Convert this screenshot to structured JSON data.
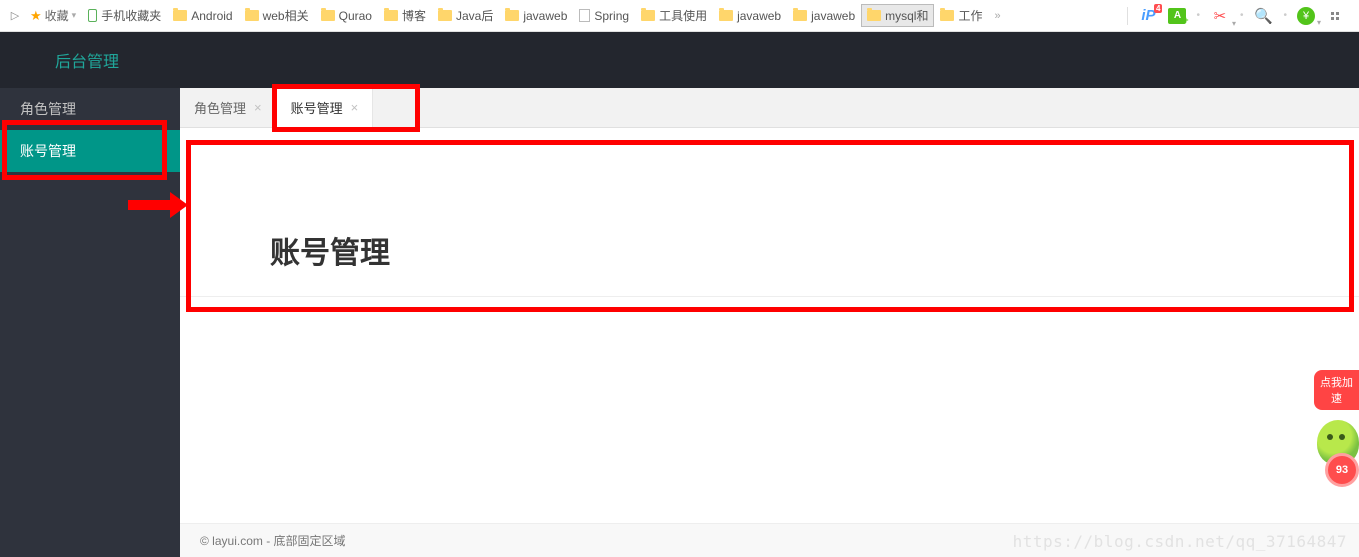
{
  "browser": {
    "favorites_label": "收藏",
    "bookmarks": [
      {
        "label": "手机收藏夹",
        "icon": "phone"
      },
      {
        "label": "Android",
        "icon": "folder"
      },
      {
        "label": "web相关",
        "icon": "folder"
      },
      {
        "label": "Qurao",
        "icon": "folder"
      },
      {
        "label": "博客",
        "icon": "folder"
      },
      {
        "label": "Java后",
        "icon": "folder"
      },
      {
        "label": "javaweb",
        "icon": "folder"
      },
      {
        "label": "Spring",
        "icon": "page"
      },
      {
        "label": "工具使用",
        "icon": "folder"
      },
      {
        "label": "javaweb",
        "icon": "folder"
      },
      {
        "label": "javaweb",
        "icon": "folder"
      },
      {
        "label": "mysql和",
        "icon": "folder",
        "selected": true
      },
      {
        "label": "工作",
        "icon": "folder"
      }
    ],
    "more": "»",
    "toolbar_badge": "4",
    "toolbar_a": "A",
    "toolbar_yen": "¥"
  },
  "app": {
    "title": "后台管理",
    "sidebar": [
      {
        "label": "角色管理",
        "active": false
      },
      {
        "label": "账号管理",
        "active": true
      }
    ],
    "tabs": [
      {
        "label": "角色管理",
        "active": false
      },
      {
        "label": "账号管理",
        "active": true
      }
    ],
    "content_heading": "账号管理",
    "footer": "© layui.com - 底部固定区域"
  },
  "widget": {
    "button": "点我加速",
    "circle": "93"
  },
  "watermark": "https://blog.csdn.net/qq_37164847"
}
